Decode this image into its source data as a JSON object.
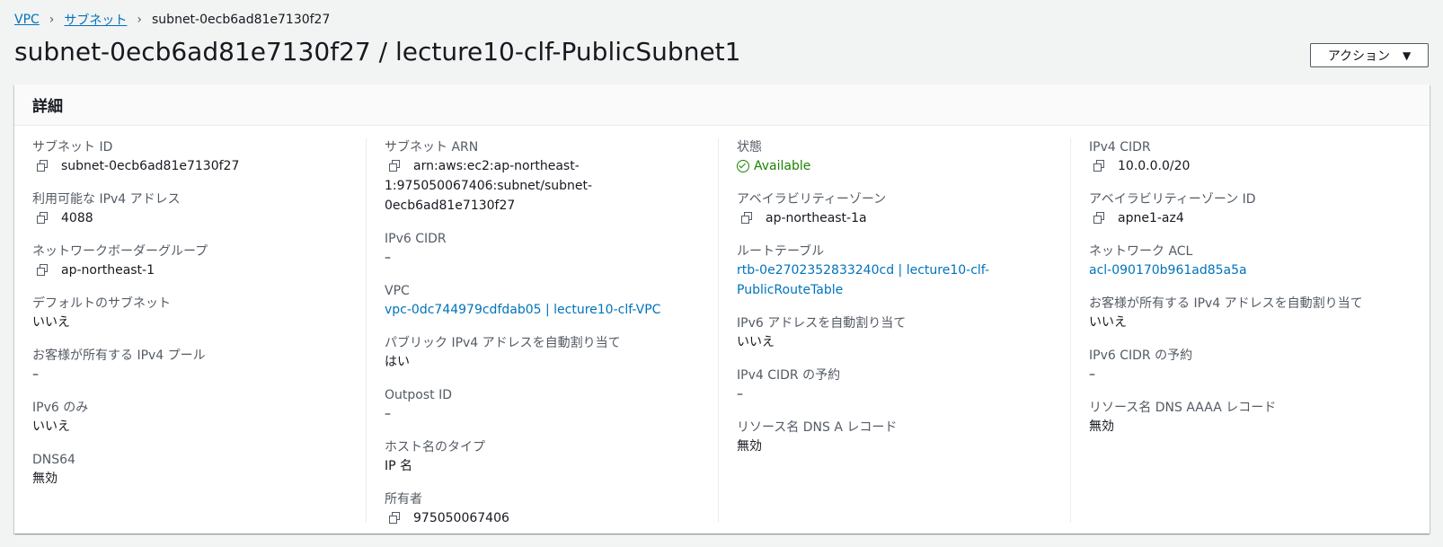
{
  "breadcrumb": {
    "vpc": "VPC",
    "subnets": "サブネット",
    "current": "subnet-0ecb6ad81e7130f27",
    "separator": "›"
  },
  "title": "subnet-0ecb6ad81e7130f27 / lecture10-clf-PublicSubnet1",
  "actions": {
    "label": "アクション",
    "caret": "▼"
  },
  "details": {
    "heading": "詳細",
    "col1": {
      "subnet_id": {
        "label": "サブネット ID",
        "value": "subnet-0ecb6ad81e7130f27"
      },
      "available_ipv4": {
        "label": "利用可能な IPv4 アドレス",
        "value": "4088"
      },
      "network_border_group": {
        "label": "ネットワークボーダーグループ",
        "value": "ap-northeast-1"
      },
      "default_subnet": {
        "label": "デフォルトのサブネット",
        "value": "いいえ"
      },
      "customer_ipv4_pool": {
        "label": "お客様が所有する IPv4 プール",
        "value": "–"
      },
      "ipv6_only": {
        "label": "IPv6 のみ",
        "value": "いいえ"
      },
      "dns64": {
        "label": "DNS64",
        "value": "無効"
      }
    },
    "col2": {
      "subnet_arn": {
        "label": "サブネット ARN",
        "value_line1": "arn:aws:ec2:ap-northeast-",
        "value_line2": "1:975050067406:subnet/subnet-0ecb6ad81e7130f27"
      },
      "ipv6_cidr": {
        "label": "IPv6 CIDR",
        "value": "–"
      },
      "vpc": {
        "label": "VPC",
        "value": "vpc-0dc744979cdfdab05 | lecture10-clf-VPC"
      },
      "auto_assign_public_ipv4": {
        "label": "パブリック IPv4 アドレスを自動割り当て",
        "value": "はい"
      },
      "outpost_id": {
        "label": "Outpost ID",
        "value": "–"
      },
      "hostname_type": {
        "label": "ホスト名のタイプ",
        "value": "IP 名"
      },
      "owner": {
        "label": "所有者",
        "value": "975050067406"
      }
    },
    "col3": {
      "state": {
        "label": "状態",
        "value": "Available"
      },
      "availability_zone": {
        "label": "アベイラビリティーゾーン",
        "value": "ap-northeast-1a"
      },
      "route_table": {
        "label": "ルートテーブル",
        "value_line1": "rtb-0e2702352833240cd | lecture10-clf-",
        "value_line2": "PublicRouteTable"
      },
      "auto_assign_ipv6": {
        "label": "IPv6 アドレスを自動割り当て",
        "value": "いいえ"
      },
      "ipv4_cidr_reservation": {
        "label": "IPv4 CIDR の予約",
        "value": "–"
      },
      "dns_a_record": {
        "label": "リソース名 DNS A レコード",
        "value": "無効"
      }
    },
    "col4": {
      "ipv4_cidr": {
        "label": "IPv4 CIDR",
        "value": "10.0.0.0/20"
      },
      "az_id": {
        "label": "アベイラビリティーゾーン ID",
        "value": "apne1-az4"
      },
      "network_acl": {
        "label": "ネットワーク ACL",
        "value": "acl-090170b961ad85a5a"
      },
      "customer_ipv4_auto": {
        "label": "お客様が所有する IPv4 アドレスを自動割り当て",
        "value": "いいえ"
      },
      "ipv6_cidr_reservation": {
        "label": "IPv6 CIDR の予約",
        "value": "–"
      },
      "dns_aaaa_record": {
        "label": "リソース名 DNS AAAA レコード",
        "value": "無効"
      }
    }
  },
  "colors": {
    "link": "#0073bb",
    "status_available": "#1d8102",
    "background": "#f2f3f3"
  }
}
